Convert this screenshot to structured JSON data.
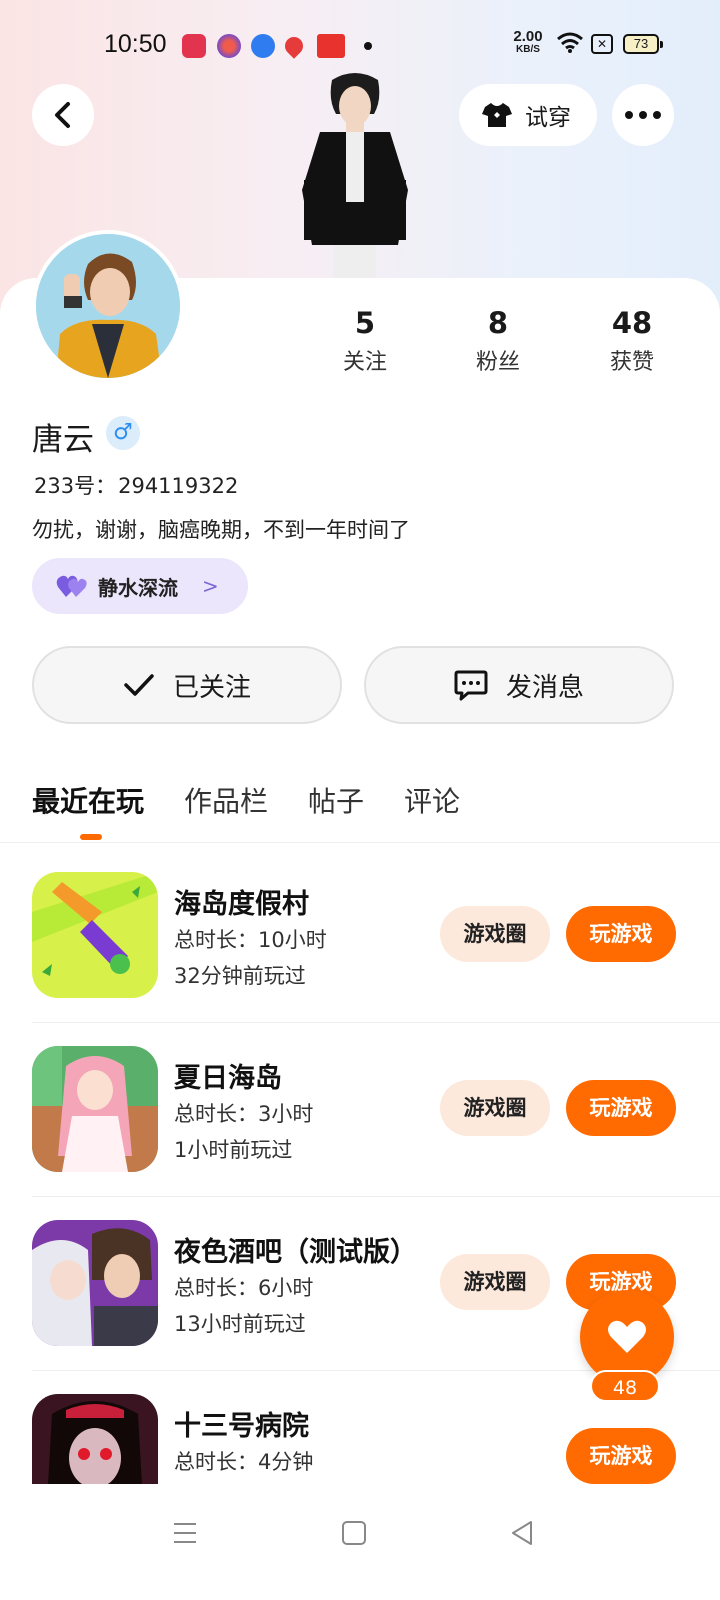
{
  "status_bar": {
    "time": "10:50",
    "net_speed_value": "2.00",
    "net_speed_unit": "KB/S",
    "battery": "73"
  },
  "header": {
    "try_on_label": "试穿"
  },
  "profile": {
    "name": "唐云",
    "gender_symbol": "♂",
    "id_label": "233号：",
    "id_value": "294119322",
    "bio": "勿扰，谢谢，脑癌晚期，不到一年时间了",
    "circle_tag": "静水深流",
    "stats": [
      {
        "value": "5",
        "label": "关注"
      },
      {
        "value": "8",
        "label": "粉丝"
      },
      {
        "value": "48",
        "label": "获赞"
      }
    ]
  },
  "actions": {
    "follow_label": "已关注",
    "message_label": "发消息"
  },
  "tabs": [
    {
      "label": "最近在玩",
      "active": true
    },
    {
      "label": "作品栏",
      "active": false
    },
    {
      "label": "帖子",
      "active": false
    },
    {
      "label": "评论",
      "active": false
    }
  ],
  "games": [
    {
      "name": "海岛度假村",
      "duration": "总时长：10小时",
      "last_played": "32分钟前玩过",
      "circle_label": "游戏圈",
      "play_label": "玩游戏",
      "icon": "knife-game-icon"
    },
    {
      "name": "夏日海岛",
      "duration": "总时长：3小时",
      "last_played": "1小时前玩过",
      "circle_label": "游戏圈",
      "play_label": "玩游戏",
      "icon": "anime-girl-game-icon"
    },
    {
      "name": "夜色酒吧（测试版）",
      "duration": "总时长：6小时",
      "last_played": "13小时前玩过",
      "circle_label": "游戏圈",
      "play_label": "玩游戏",
      "icon": "couple-game-icon"
    },
    {
      "name": "十三号病院",
      "duration": "总时长：4分钟",
      "last_played": "",
      "circle_label": "",
      "play_label": "玩游戏",
      "icon": "horror-game-icon"
    }
  ],
  "like_fab": {
    "count": "48"
  },
  "colors": {
    "accent": "#ff6b00",
    "circle_tag_bg": "#ebe6fb",
    "game_circle_bg": "#fde8dc"
  }
}
